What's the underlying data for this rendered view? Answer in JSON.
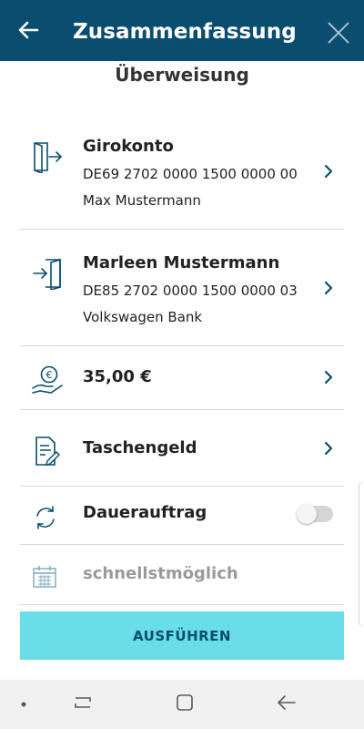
{
  "header": {
    "title": "Zusammenfassung"
  },
  "subtitle": "Überweisung",
  "from_account": {
    "title": "Girokonto",
    "iban": "DE69 2702 0000 1500 0000 00",
    "holder": "Max Mustermann"
  },
  "recipient": {
    "name": "Marleen Mustermann",
    "iban": "DE85 2702 0000 1500 0000 03",
    "bank": "Volkswagen Bank"
  },
  "amount": {
    "value": "35,00 €"
  },
  "purpose": {
    "text": "Taschengeld"
  },
  "standing_order": {
    "label": "Dauerauftrag",
    "enabled": false
  },
  "date": {
    "label": "schnellstmöglich"
  },
  "execute_button": {
    "label": "AUSFÜHREN"
  },
  "colors": {
    "header_bg": "#0b4d6e",
    "accent": "#69dde8",
    "icon": "#0b4d6e",
    "muted": "#9a9a9a"
  }
}
